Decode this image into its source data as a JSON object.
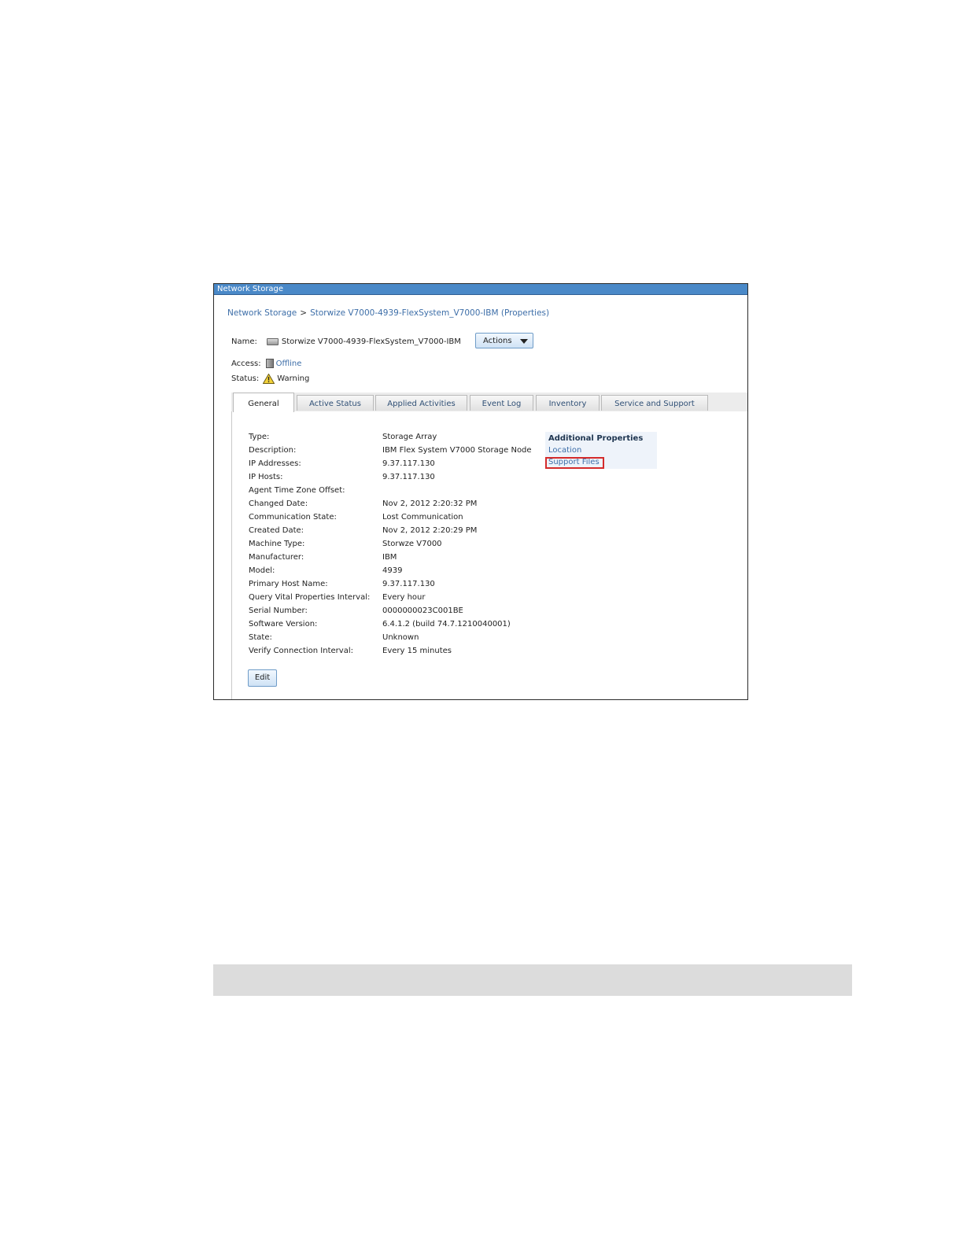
{
  "window": {
    "title": "Network Storage"
  },
  "breadcrumb": {
    "root": "Network Storage",
    "separator": ">",
    "current": "Storwize V7000-4939-FlexSystem_V7000-IBM (Properties)"
  },
  "name_row": {
    "label": "Name:",
    "value": "Storwize V7000-4939-FlexSystem_V7000-IBM",
    "actions_label": "Actions"
  },
  "access_row": {
    "label": "Access:",
    "value": "Offline"
  },
  "status_row": {
    "label": "Status:",
    "value": "Warning"
  },
  "tabs": [
    {
      "label": "General",
      "active": true
    },
    {
      "label": "Active Status"
    },
    {
      "label": "Applied Activities"
    },
    {
      "label": "Event Log"
    },
    {
      "label": "Inventory"
    },
    {
      "label": "Service and Support"
    }
  ],
  "properties": [
    {
      "key": "Type:",
      "value": "Storage Array"
    },
    {
      "key": "Description:",
      "value": "IBM Flex System V7000 Storage Node"
    },
    {
      "key": "IP Addresses:",
      "value": "9.37.117.130"
    },
    {
      "key": "IP Hosts:",
      "value": "9.37.117.130"
    },
    {
      "key": "Agent Time Zone Offset:",
      "value": ""
    },
    {
      "key": "Changed Date:",
      "value": "Nov 2, 2012 2:20:32 PM"
    },
    {
      "key": "Communication State:",
      "value": "Lost Communication"
    },
    {
      "key": "Created Date:",
      "value": "Nov 2, 2012 2:20:29 PM"
    },
    {
      "key": "Machine Type:",
      "value": "Storwze V7000"
    },
    {
      "key": "Manufacturer:",
      "value": "IBM"
    },
    {
      "key": "Model:",
      "value": "4939"
    },
    {
      "key": "Primary Host Name:",
      "value": "9.37.117.130"
    },
    {
      "key": "Query Vital Properties Interval:",
      "value": "Every hour"
    },
    {
      "key": "Serial Number:",
      "value": "0000000023C001BE"
    },
    {
      "key": "Software Version:",
      "value": "6.4.1.2 (build 74.7.1210040001)"
    },
    {
      "key": "State:",
      "value": "Unknown"
    },
    {
      "key": "Verify Connection Interval:",
      "value": "Every 15 minutes"
    }
  ],
  "additional_properties": {
    "title": "Additional Properties",
    "links": [
      "Location",
      "Support Files"
    ]
  },
  "edit_label": "Edit",
  "colors": {
    "titlebar": "#4a89c8",
    "link": "#3d6ea8",
    "highlight": "#d42b2b"
  }
}
